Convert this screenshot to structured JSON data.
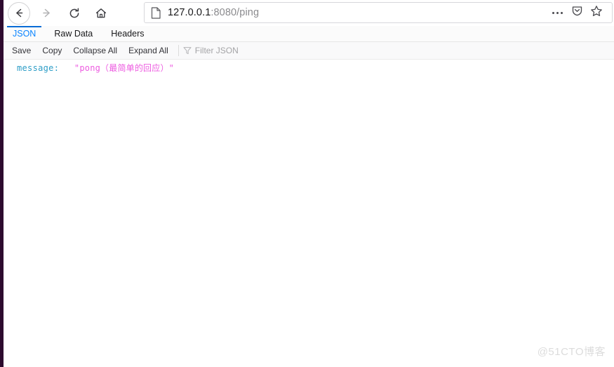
{
  "window": {
    "edge_color": "#2d0a2e"
  },
  "navigation": {
    "back_label": "Back",
    "forward_label": "Forward",
    "reload_label": "Reload",
    "home_label": "Home",
    "back_icon": "arrow-left-icon",
    "forward_icon": "arrow-right-icon",
    "reload_icon": "reload-icon",
    "home_icon": "home-icon"
  },
  "urlbar": {
    "page_icon": "page-document-icon",
    "host": "127.0.0.1",
    "path": ":8080/ping",
    "full_url": "127.0.0.1:8080/ping",
    "menu_icon": "ellipsis-icon",
    "pocket_icon": "pocket-shield-icon",
    "bookmark_icon": "star-icon",
    "host_color": "#18181a",
    "path_color": "#8a8a8d"
  },
  "viewer": {
    "tabs": [
      {
        "label": "JSON",
        "active": true
      },
      {
        "label": "Raw Data",
        "active": false
      },
      {
        "label": "Headers",
        "active": false
      }
    ],
    "active_tab_color": "#0a84ff",
    "toolbar": {
      "save_label": "Save",
      "copy_label": "Copy",
      "collapse_all_label": "Collapse All",
      "expand_all_label": "Expand All",
      "filter_icon": "filter-funnel-icon",
      "filter_placeholder": "Filter JSON",
      "filter_value": ""
    },
    "content": {
      "rows": [
        {
          "key": "message",
          "colon": ":",
          "value": "\"pong（最简单的回应）\"",
          "key_color": "#2e9ec7",
          "value_color": "#ed5be0"
        }
      ]
    }
  },
  "watermark": {
    "text": "@51CTO博客"
  }
}
